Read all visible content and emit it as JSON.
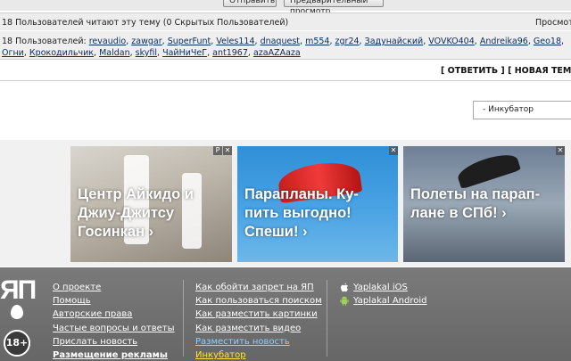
{
  "top": {
    "send_label": "Отправить",
    "preview_label": "Предварительный просмотр"
  },
  "viewers": {
    "count_text": "18 Пользователей читают эту тему (0 Скрытых Пользователей)",
    "right_text": "Просмот"
  },
  "users": {
    "label": "18 Пользователей:",
    "names": [
      "revaudio",
      "zawgar",
      "SuperFunt",
      "Veles114",
      "dnaquest",
      "m554",
      "zgr24",
      "Задунайский",
      "VOVKO404",
      "Andreika96",
      "Geo18",
      "Огни",
      "Крокодильчик",
      "Maldan",
      "skyfil",
      "ЧайНиЧеГ",
      "ant1967",
      "azaAZAaza"
    ]
  },
  "actions": {
    "reply": "[ ОТВЕТИТЬ ]",
    "new_topic": "[ НОВАЯ ТЕМА"
  },
  "forum_select": {
    "value": "- Инкубатор"
  },
  "ads": [
    {
      "text": "Центр Айкидо и Джиу-Джитсу Госинкан ›",
      "close": "✕",
      "tag": "P"
    },
    {
      "text": "Парапланы. Ку-пить выгодно! Спеши! ›",
      "close": "✕"
    },
    {
      "text": "Полеты на парап-лане в СПб! ›",
      "close": "✕"
    }
  ],
  "footer": {
    "logo": "ЯП",
    "age_badge": "18+",
    "col1": [
      "О проекте",
      "Помощь",
      "Авторские права",
      "Частые вопросы и ответы",
      "Прислать новость",
      "Размещение рекламы"
    ],
    "col2": [
      "Как обойти запрет на ЯП",
      "Как пользоваться поиском",
      "Как разместить картинки",
      "Как разместить видео",
      "Разместить новость",
      "Инкубатор"
    ],
    "col3": [
      "Yaplakal iOS",
      "Yaplakal Android"
    ]
  },
  "colors": {
    "link": "#0a2b5c",
    "footer_bg": "#6f6f6f",
    "footer_highlight_cyan": "#8fd0ff",
    "footer_highlight_yellow": "#ffe23f"
  }
}
